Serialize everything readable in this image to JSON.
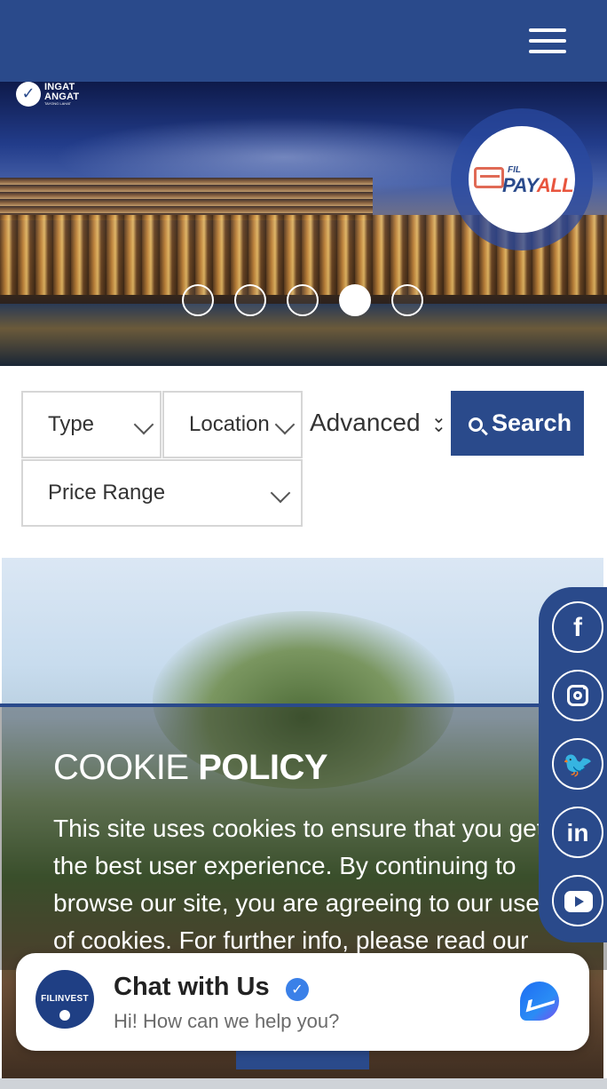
{
  "header": {
    "menu_icon": "hamburger-menu-icon"
  },
  "hero": {
    "logo": {
      "line1": "INGAT",
      "line2": "ANGAT",
      "tagline": "TAYONG LAHAT"
    },
    "payall": {
      "prefix": "FIL",
      "brand_main": "PAY",
      "brand_accent": "ALL"
    },
    "slides_count": 5,
    "active_slide": 4
  },
  "filters": {
    "type_label": "Type",
    "location_label": "Location",
    "price_label": "Price Range",
    "advanced_label": "Advanced",
    "search_label": "Search"
  },
  "cookie": {
    "title_light": "COOKIE ",
    "title_bold": "POLICY",
    "lines": [
      "This site uses cookies to ensure that you get",
      "the best user experience. By continuing to",
      "browse our site, you are agreeing to our use",
      "of cookies. For further info, please read our"
    ]
  },
  "social": {
    "icons": [
      "facebook-icon",
      "instagram-icon",
      "twitter-icon",
      "linkedin-icon",
      "youtube-icon"
    ],
    "facebook_glyph": "f",
    "twitter_glyph": "🐦",
    "linkedin_glyph": "in"
  },
  "chat": {
    "avatar_text": "FILINVEST",
    "title": "Chat with Us",
    "subtitle": "Hi! How can we help you?",
    "verified_glyph": "✓"
  },
  "colors": {
    "brand_blue": "#2a4a8b",
    "accent_red": "#e8553e",
    "messenger_blue": "#1e6cf2"
  }
}
